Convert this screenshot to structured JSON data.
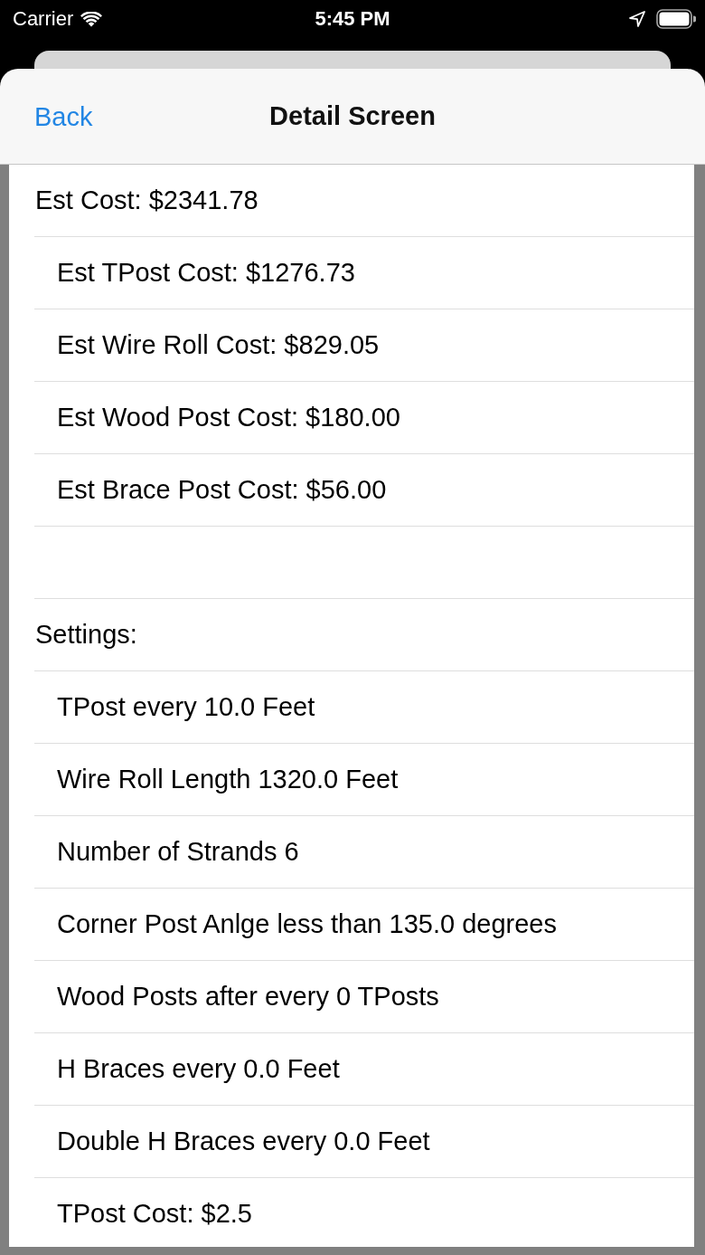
{
  "status_bar": {
    "carrier": "Carrier",
    "time": "5:45 PM"
  },
  "nav_bar": {
    "back": "Back",
    "title": "Detail Screen"
  },
  "sections": [
    {
      "header": "Est Cost: $2341.78",
      "items": [
        "Est TPost Cost: $1276.73",
        "Est Wire Roll Cost: $829.05",
        "Est Wood Post Cost: $180.00",
        "Est Brace Post Cost: $56.00"
      ]
    },
    {
      "header": "Settings:",
      "items": [
        "TPost every 10.0 Feet",
        "Wire Roll Length 1320.0 Feet",
        "Number of Strands 6",
        "Corner Post Anlge less than 135.0 degrees",
        "Wood Posts after every 0 TPosts",
        "H Braces every 0.0 Feet",
        "Double H Braces every 0.0 Feet",
        "TPost Cost: $2.5"
      ]
    }
  ]
}
